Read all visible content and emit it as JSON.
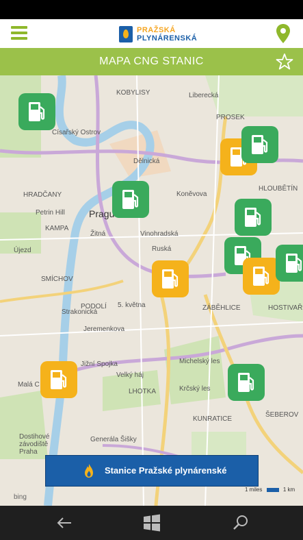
{
  "app": {
    "logo_line1": "PRAŽSKÁ",
    "logo_line2": "PLYNÁRENSKÁ",
    "title": "MAPA CNG STANIC"
  },
  "icons": {
    "menu": "hamburger-icon",
    "location": "location-pin-icon",
    "favorite": "star-icon",
    "back": "back-arrow-icon",
    "home": "windows-icon",
    "search": "search-icon"
  },
  "colors": {
    "accent_green": "#9bc14a",
    "brand_blue": "#1b5fa8",
    "brand_orange": "#f5a623",
    "station_green": "#3aaa5c",
    "station_yellow": "#f5b21b"
  },
  "map": {
    "labels": [
      {
        "id": "praha",
        "text": "Prague"
      },
      {
        "id": "vinohradska",
        "text": "Vinohradská"
      },
      {
        "id": "kampa",
        "text": "KAMPA"
      },
      {
        "id": "petrin",
        "text": "Petrin Hill"
      },
      {
        "id": "smichov",
        "text": "SMÍCHOV"
      },
      {
        "id": "podoli",
        "text": "PODOLÍ"
      },
      {
        "id": "jizni",
        "text": "Jižní Spojka"
      },
      {
        "id": "jeremenkova",
        "text": "Jeremenkova"
      },
      {
        "id": "michelsky",
        "text": "Michelský les"
      },
      {
        "id": "krcsky",
        "text": "Krčský les"
      },
      {
        "id": "lhotka",
        "text": "LHOTKA"
      },
      {
        "id": "kunratice",
        "text": "KUNRATICE"
      },
      {
        "id": "sebeov",
        "text": "ŠEBEROV"
      },
      {
        "id": "generala",
        "text": "Generála Šišky"
      },
      {
        "id": "mala",
        "text": "Malá C"
      },
      {
        "id": "hradcany",
        "text": "HRADČANY"
      },
      {
        "id": "delnicka",
        "text": "Dělnická"
      },
      {
        "id": "konevova",
        "text": "Koněvova"
      },
      {
        "id": "zitna",
        "text": "Žitná"
      },
      {
        "id": "ruska",
        "text": "Ruská"
      },
      {
        "id": "zabehlice",
        "text": "ZÁBĚHLICE"
      },
      {
        "id": "hostivar",
        "text": "HOSTIVAŘ"
      },
      {
        "id": "dostihove",
        "text": "Dostihové závodiště Praha"
      },
      {
        "id": "cisarsky",
        "text": "Císařský Ostrov"
      },
      {
        "id": "kobylisy",
        "text": "KOBYLISY"
      },
      {
        "id": "proseck",
        "text": "PROSEK"
      },
      {
        "id": "hloubetin",
        "text": "HLOUBĚTÍN"
      },
      {
        "id": "liberecka",
        "text": "Liberecká"
      },
      {
        "id": "strakonicka",
        "text": "Strakonická"
      },
      {
        "id": "kvetna",
        "text": "5. května"
      },
      {
        "id": "velky",
        "text": "Velký háj"
      },
      {
        "id": "ujezd",
        "text": "Újezd"
      }
    ],
    "stations": [
      {
        "type": "green"
      },
      {
        "type": "yellow"
      },
      {
        "type": "green"
      },
      {
        "type": "green"
      },
      {
        "type": "green"
      },
      {
        "type": "green"
      },
      {
        "type": "yellow"
      },
      {
        "type": "green"
      },
      {
        "type": "yellow"
      },
      {
        "type": "yellow"
      },
      {
        "type": "green"
      }
    ]
  },
  "banner": {
    "label": "Stanice Pražské plynárenské"
  },
  "scale": {
    "miles": "1 miles",
    "km": "1 km"
  },
  "attribution": "bing"
}
